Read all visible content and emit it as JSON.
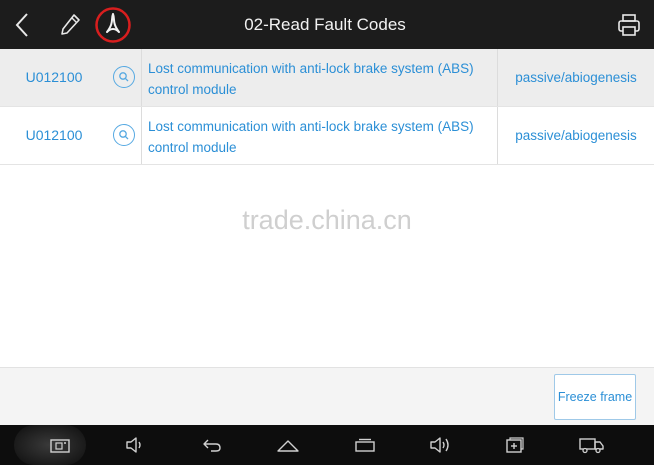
{
  "header": {
    "title": "02-Read Fault Codes",
    "icons": {
      "back": "back-chevron-icon",
      "edit": "pencil-icon",
      "pdf": "pdf-icon",
      "print": "printer-icon"
    },
    "pdf_highlight_color": "#d81e1e"
  },
  "fault_codes": [
    {
      "code": "U012100",
      "description": "Lost communication with anti-lock brake system (ABS) control module",
      "status": "passive/abiogenesis"
    },
    {
      "code": "U012100",
      "description": "Lost communication with anti-lock brake system (ABS) control module",
      "status": "passive/abiogenesis"
    }
  ],
  "watermark": "trade.china.cn",
  "footer": {
    "freeze_frame_label": "Freeze frame"
  },
  "navbar": {
    "icons": [
      "screenshot-icon",
      "volume-down-icon",
      "back-arrow-icon",
      "home-icon",
      "recent-apps-icon",
      "volume-up-icon",
      "add-window-icon",
      "truck-icon"
    ]
  },
  "colors": {
    "accent": "#2b8fd6",
    "topbar": "#1c1c1c",
    "navbar": "#0d0d0d",
    "row_alt": "#ededed"
  }
}
